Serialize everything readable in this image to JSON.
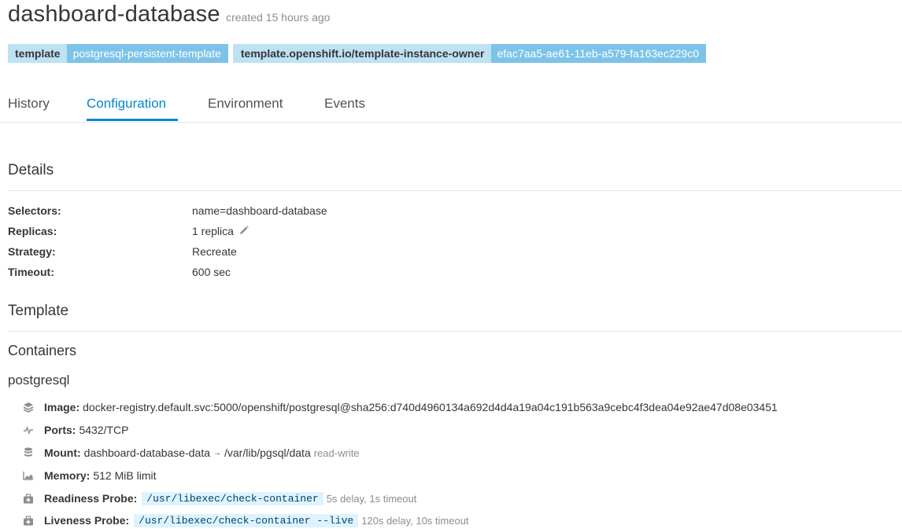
{
  "header": {
    "title": "dashboard-database",
    "created": "created 15 hours ago"
  },
  "labels": [
    {
      "key": "template",
      "value": "postgresql-persistent-template"
    },
    {
      "key": "template.openshift.io/template-instance-owner",
      "value": "efac7aa5-ae61-11eb-a579-fa163ec229c0"
    }
  ],
  "tabs": [
    "History",
    "Configuration",
    "Environment",
    "Events"
  ],
  "active_tab": "Configuration",
  "details": {
    "heading": "Details",
    "selectors_label": "Selectors:",
    "selectors_value": "name=dashboard-database",
    "replicas_label": "Replicas:",
    "replicas_value": "1 replica",
    "strategy_label": "Strategy:",
    "strategy_value": "Recreate",
    "timeout_label": "Timeout:",
    "timeout_value": "600 sec"
  },
  "template": {
    "heading": "Template",
    "containers_heading": "Containers",
    "container_name": "postgresql",
    "image_label": "Image:",
    "image_value": "docker-registry.default.svc:5000/openshift/postgresql@sha256:d740d4960134a692d4d4a19a04c191b563a9cebc4f3dea04e92ae47d08e03451",
    "ports_label": "Ports:",
    "ports_value": "5432/TCP",
    "mount_label": "Mount:",
    "mount_source": "dashboard-database-data",
    "mount_arrow": "→",
    "mount_path": "/var/lib/pgsql/data",
    "mount_mode": "read-write",
    "memory_label": "Memory:",
    "memory_value": "512 MiB limit",
    "readiness_label": "Readiness Probe:",
    "readiness_cmd": "/usr/libexec/check-container",
    "readiness_timing": "5s delay, 1s timeout",
    "liveness_label": "Liveness Probe:",
    "liveness_cmd": "/usr/libexec/check-container --live",
    "liveness_timing": "120s delay, 10s timeout"
  },
  "icons": {
    "image": "layers-icon",
    "ports": "pulse-icon",
    "mount": "database-icon",
    "memory": "area-chart-icon",
    "probe": "medkit-icon",
    "edit": "pencil-icon"
  },
  "colors": {
    "accent": "#0088ce",
    "label_key_bg": "#bee1f4",
    "label_value_bg": "#7dc3e8",
    "code_bg": "#def3ff"
  }
}
